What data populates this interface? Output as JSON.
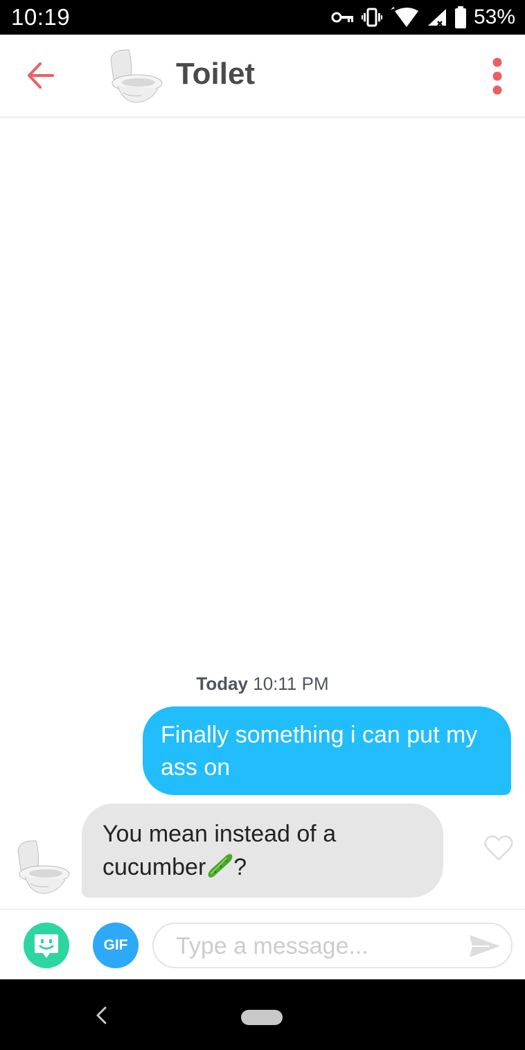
{
  "status_bar": {
    "time": "10:19",
    "battery": "53%",
    "icons": [
      "vpn-key-icon",
      "vibrate-icon",
      "wifi-icon",
      "signal-icon",
      "battery-icon"
    ]
  },
  "header": {
    "title": "Toilet",
    "back_icon": "arrow-left-icon",
    "menu_icon": "more-vertical-icon",
    "accent_color": "#ed5e62"
  },
  "conversation": {
    "timestamp": {
      "day": "Today",
      "time": "10:11 PM"
    },
    "messages": [
      {
        "direction": "outgoing",
        "text": "Finally something i can put my ass on",
        "color": "#21bdfd"
      },
      {
        "direction": "incoming",
        "text_before": "You mean instead of a cucumber",
        "emoji": "cucumber-icon",
        "text_after": "?",
        "color": "#e6e6e6"
      }
    ]
  },
  "composer": {
    "gif_label": "GIF",
    "placeholder": "Type a message...",
    "sticker_icon": "sticker-icon",
    "send_icon": "send-icon"
  },
  "nav_bar": {
    "icons": [
      "nav-back-icon",
      "home-pill-icon"
    ]
  }
}
